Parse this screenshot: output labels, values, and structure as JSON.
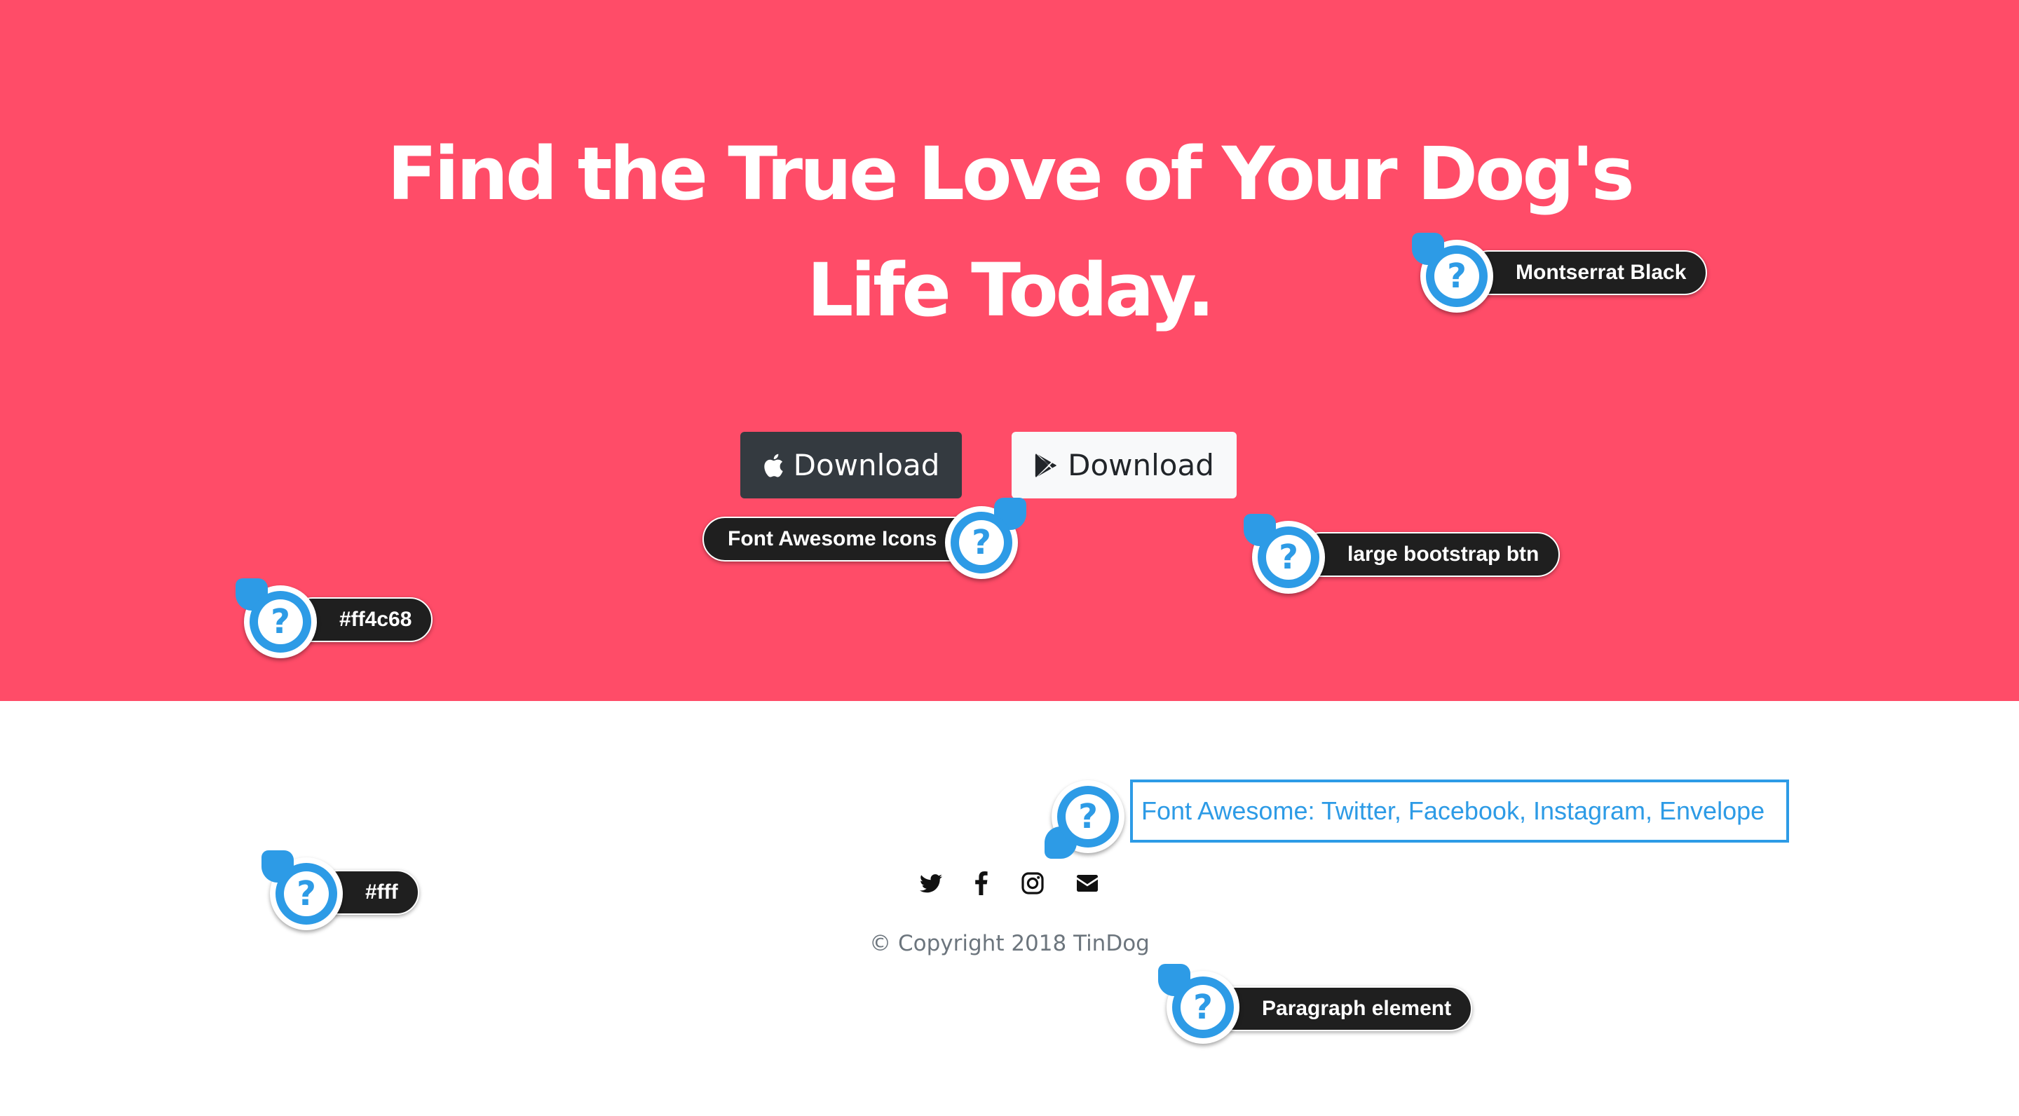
{
  "hero": {
    "background_color": "#ff4c68",
    "title": "Find the True Love of Your Dog's Life Today.",
    "buttons": [
      {
        "label": "Download",
        "icon": "apple-icon",
        "style": "dark"
      },
      {
        "label": "Download",
        "icon": "google-play-icon",
        "style": "light"
      }
    ]
  },
  "footer": {
    "background_color": "#ffffff",
    "social_icons": [
      "twitter-icon",
      "facebook-icon",
      "instagram-icon",
      "envelope-icon"
    ],
    "copyright": "© Copyright 2018 TinDog"
  },
  "annotations": {
    "font": "Montserrat Black",
    "icons": "Font Awesome Icons",
    "button": "large bootstrap btn",
    "hero_color": "#ff4c68",
    "footer_color": "#fff",
    "social": "Font Awesome: Twitter, Facebook, Instagram, Envelope",
    "paragraph": "Paragraph element"
  }
}
